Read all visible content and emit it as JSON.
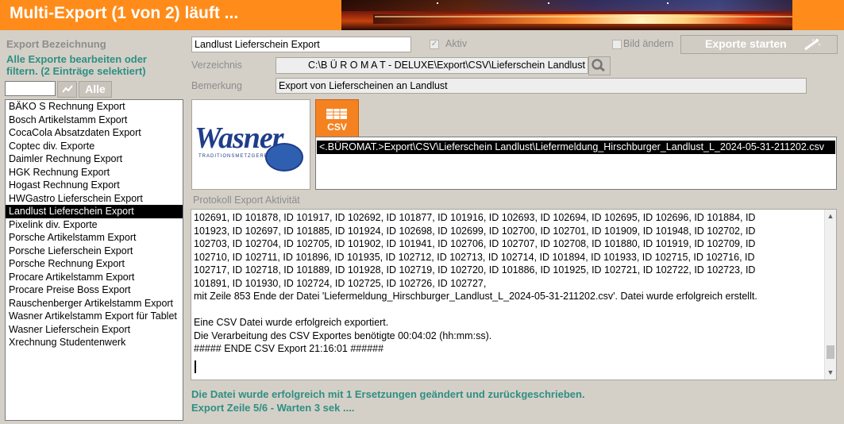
{
  "window": {
    "title": "Multi-Export (1 von 2) läuft ..."
  },
  "colors": {
    "accent": "#ff8c1a",
    "teal": "#2f8f82",
    "label_grey": "#8d8d8d"
  },
  "left": {
    "heading": "Export Bezeichnung",
    "note": "Alle Exporte bearbeiten oder filtern. (2 Einträge selektiert)",
    "filter_value": "",
    "alle_label": "Alle",
    "items": [
      "BÄKO S Rechnung Export",
      "Bosch Artikelstamm Export",
      "CocaCola Absatzdaten Export",
      "Coptec div. Exporte",
      "Daimler Rechnung Export",
      "HGK Rechnung Export",
      "Hogast Rechnung Export",
      "HWGastro Lieferschein Export",
      "Landlust Lieferschein Export",
      "Pixelink div. Exporte",
      "Porsche Artikelstamm Export",
      "Porsche Lieferschein Export",
      "Porsche Rechnung Export",
      "Procare Artikelstamm Export",
      "Procare Preise Boss Export",
      "Rauschenberger Artikelstamm Export",
      "Wasner Artikelstamm Export für Tablet",
      "Wasner Lieferschein Export",
      "Xrechnung Studentenwerk"
    ],
    "selected_index": 8
  },
  "form": {
    "name_value": "Landlust Lieferschein Export",
    "aktiv_label": "Aktiv",
    "bild_label": "Bild ändern",
    "start_label": "Exporte starten",
    "verzeichnis_label": "Verzeichnis",
    "verzeichnis_value": "C:\\B Ü R O M A T - DELUXE\\Export\\CSV\\Lieferschein Landlust",
    "bemerkung_label": "Bemerkung",
    "bemerkung_value": "Export von Lieferscheinen an Landlust"
  },
  "logo": {
    "word": "Wasner",
    "sub": "TRADITIONSMETZGEREI"
  },
  "csv_icon_label": "CSV",
  "file_entry": "<.BÜROMAT.>Export\\CSV\\Lieferschein Landlust\\Liefermeldung_Hirschburger_Landlust_L_2024-05-31-211202.csv",
  "protocol": {
    "label": "Protokoll Export Aktivität",
    "text": "102691, ID 101878, ID 101917, ID 102692, ID 101877, ID 101916, ID 102693, ID 102694, ID 102695, ID 102696, ID 101884, ID\n101923, ID 102697, ID 101885, ID 101924, ID 102698, ID 102699, ID 102700, ID 102701, ID 101909, ID 101948, ID 102702, ID\n102703, ID 102704, ID 102705, ID 101902, ID 101941, ID 102706, ID 102707, ID 102708, ID 101880, ID 101919, ID 102709, ID\n102710, ID 102711, ID 101896, ID 101935, ID 102712, ID 102713, ID 102714, ID 101894, ID 101933, ID 102715, ID 102716, ID\n102717, ID 102718, ID 101889, ID 101928, ID 102719, ID 102720, ID 101886, ID 101925, ID 102721, ID 102722, ID 102723, ID\n101891, ID 101930, ID 102724, ID 102725, ID 102726, ID 102727,\nmit Zeile 853 Ende der Datei 'Liefermeldung_Hirschburger_Landlust_L_2024-05-31-211202.csv'. Datei wurde erfolgreich erstellt.\n\nEine CSV Datei wurde erfolgreich exportiert.\nDie Verarbeitung des CSV Exportes benötigte 00:04:02 (hh:mm:ss).\n##### ENDE CSV Export 21:16:01 ######"
  },
  "status": {
    "line1": "Die Datei wurde erfolgreich mit 1 Ersetzungen geändert und zurückgeschrieben.",
    "line2": "Export Zeile 5/6 - Warten 3 sek ...."
  }
}
